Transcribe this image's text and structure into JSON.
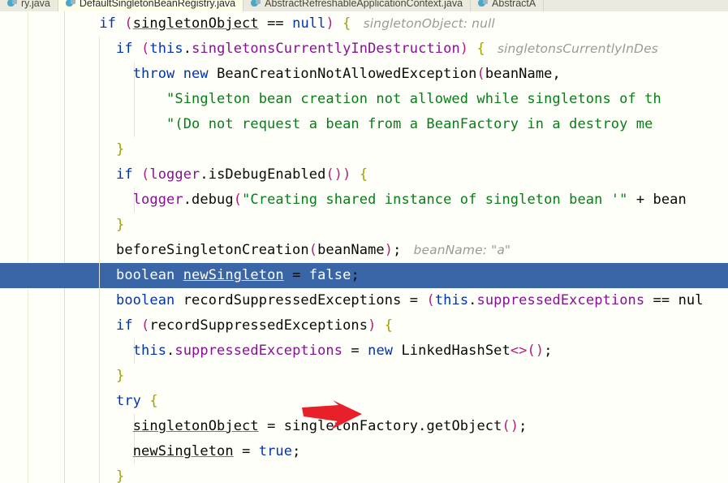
{
  "window": {
    "app": "IntelliJ IDEA",
    "accent_color": "#4a86c5",
    "editor_background": "#fffffa",
    "execution_line_color": "#3a66a8"
  },
  "tabs": [
    {
      "label": "ry.java",
      "icon": "java-class-icon",
      "active": false
    },
    {
      "label": "DefaultSingletonBeanRegistry.java",
      "icon": "java-class-icon",
      "active": true
    },
    {
      "label": "AbstractRefreshableApplicationContext.java",
      "icon": "java-class-icon",
      "active": false
    },
    {
      "label": "AbstractA",
      "icon": "java-class-icon",
      "active": false
    }
  ],
  "annotation": {
    "type": "red-arrow",
    "color": "#e8202a",
    "points_at": "singletonObject = singletonFactory.getObject();"
  },
  "code": {
    "file": "DefaultSingletonBeanRegistry.java",
    "language": "java",
    "execution_line_index": 10,
    "lines": [
      {
        "indent": 2,
        "text": "if (singletonObject == null) {",
        "hint": "singletonObject: null",
        "guides": []
      },
      {
        "indent": 3,
        "text": "if (this.singletonsCurrentlyInDestruction) {",
        "hint": "singletonsCurrentlyInDes",
        "guides": [
          "i2"
        ]
      },
      {
        "indent": 4,
        "text": "throw new BeanCreationNotAllowedException(beanName,",
        "hint": "",
        "guides": [
          "i2",
          "i3"
        ]
      },
      {
        "indent": 6,
        "text": "\"Singleton bean creation not allowed while singletons of th",
        "hint": "",
        "guides": [
          "i2",
          "i3"
        ]
      },
      {
        "indent": 6,
        "text": "\"(Do not request a bean from a BeanFactory in a destroy me",
        "hint": "",
        "guides": [
          "i2",
          "i3"
        ]
      },
      {
        "indent": 3,
        "text": "}",
        "hint": "",
        "guides": [
          "i2"
        ]
      },
      {
        "indent": 3,
        "text": "if (logger.isDebugEnabled()) {",
        "hint": "",
        "guides": [
          "i2"
        ]
      },
      {
        "indent": 4,
        "text": "logger.debug(\"Creating shared instance of singleton bean '\" + bean",
        "hint": "",
        "guides": [
          "i2",
          "i3"
        ]
      },
      {
        "indent": 3,
        "text": "}",
        "hint": "",
        "guides": [
          "i2"
        ]
      },
      {
        "indent": 3,
        "text": "beforeSingletonCreation(beanName);",
        "hint": "beanName: \"a\"",
        "guides": [
          "i2"
        ]
      },
      {
        "indent": 3,
        "text": "boolean newSingleton = false;",
        "hint": "",
        "guides": [
          "i2"
        ]
      },
      {
        "indent": 3,
        "text": "boolean recordSuppressedExceptions = (this.suppressedExceptions == nul",
        "hint": "",
        "guides": [
          "i2"
        ]
      },
      {
        "indent": 3,
        "text": "if (recordSuppressedExceptions) {",
        "hint": "",
        "guides": [
          "i2"
        ]
      },
      {
        "indent": 4,
        "text": "this.suppressedExceptions = new LinkedHashSet<>();",
        "hint": "",
        "guides": [
          "i2",
          "i3"
        ]
      },
      {
        "indent": 3,
        "text": "}",
        "hint": "",
        "guides": [
          "i2"
        ]
      },
      {
        "indent": 3,
        "text": "try {",
        "hint": "",
        "guides": [
          "i2"
        ]
      },
      {
        "indent": 4,
        "text": "singletonObject = singletonFactory.getObject();",
        "hint": "",
        "guides": [
          "i2",
          "i3"
        ]
      },
      {
        "indent": 4,
        "text": "newSingleton = true;",
        "hint": "",
        "guides": [
          "i2",
          "i3"
        ]
      },
      {
        "indent": 3,
        "text": "}",
        "hint": "",
        "guides": [
          "i2"
        ]
      }
    ]
  }
}
